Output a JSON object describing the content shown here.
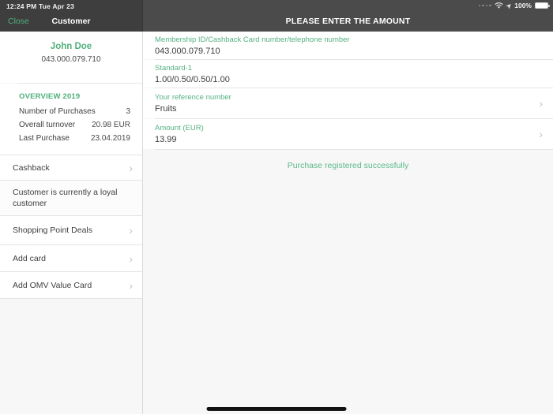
{
  "status_bar": {
    "time_date": "12:24 PM  Tue Apr 23",
    "battery_percent": "100%"
  },
  "nav": {
    "close_label": "Close",
    "sidebar_title": "Customer",
    "main_title": "PLEASE ENTER THE AMOUNT"
  },
  "sidebar": {
    "customer_name": "John Doe",
    "customer_number": "043.000.079.710",
    "overview": {
      "title": "OVERVIEW 2019",
      "rows": [
        {
          "label": "Number of Purchases",
          "value": "3"
        },
        {
          "label": "Overall turnover",
          "value": "20.98 EUR"
        },
        {
          "label": "Last Purchase",
          "value": "23.04.2019"
        }
      ]
    },
    "cashback_label": "Cashback",
    "loyalty_note": "Customer is currently a loyal customer",
    "menu": [
      {
        "label": "Shopping Point Deals"
      },
      {
        "label": "Add card"
      },
      {
        "label": "Add OMV Value Card"
      }
    ]
  },
  "main": {
    "fields": [
      {
        "label": "Membership ID/Cashback Card number/telephone number",
        "value": "043.000.079.710"
      },
      {
        "label": "Standard-1",
        "value": "1.00/0.50/0.50/1.00"
      },
      {
        "label": "Your reference number",
        "value": "Fruits"
      },
      {
        "label": "Amount (EUR)",
        "value": "13.99"
      }
    ],
    "status_message": "Purchase registered successfully"
  },
  "icons": {
    "chevron": "›",
    "location_arrow": "➤"
  },
  "colors": {
    "accent_green": "#4fb07d",
    "header_left": "#3e3e3e",
    "header_right": "#4b4b4b",
    "page_background": "#f7f7f7"
  }
}
